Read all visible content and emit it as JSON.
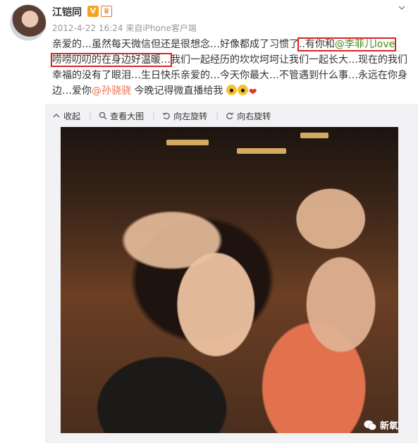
{
  "post": {
    "username": "江铠同",
    "badge_v": "V",
    "badge_vip": "♛",
    "timestamp": "2012-4-22 16:24",
    "source_prefix": "来自",
    "source": "iPhone客户端",
    "text_1": "亲爱的…虽然每天微信但还是很想念…好像都成了习惯了",
    "text_2_hl": "..有你和",
    "mention_1": "@李菲儿love",
    "text_3_hl": "唠唠叨叨的在身边好温暖…",
    "text_4": "我们一起经历的坎坎坷坷让我们一起长大…现在的我们幸福的没有了眼泪…生日快乐亲爱的…今天你最大…不管遇到什么事…永远在你身边…爱你",
    "mention_2": "@孙骁骁",
    "text_5": " 今晚记得微直播给我"
  },
  "toolbar": {
    "collapse": "收起",
    "view_large": "查看大图",
    "rotate_left": "向左旋转",
    "rotate_right": "向右旋转",
    "separator": "|"
  },
  "watermark": {
    "label": "新氧"
  },
  "icons": {
    "more": "chevron-down-icon",
    "collapse": "arrow-up-icon",
    "view_large": "magnifier-icon",
    "rotate_left": "rotate-left-icon",
    "rotate_right": "rotate-right-icon",
    "wechat": "wechat-icon"
  },
  "colors": {
    "mention": "#eb7350",
    "mention_alt": "#4a8a1c",
    "highlight_box": "#e02020",
    "toolbar_bg": "#f2f2f5"
  }
}
